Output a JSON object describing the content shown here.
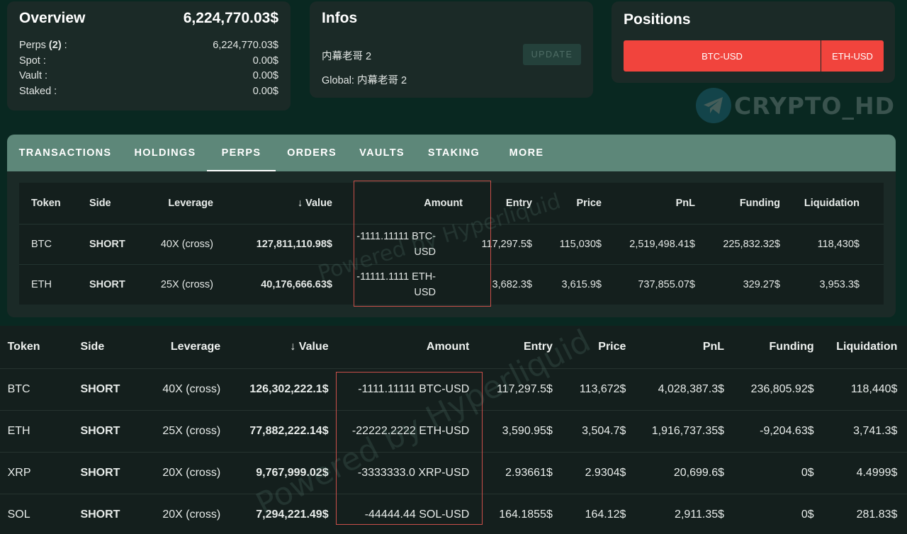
{
  "overview": {
    "title": "Overview",
    "total": "6,224,770.03$",
    "rows": [
      {
        "label_prefix": "Perps ",
        "count": "(2)",
        "label_suffix": " :",
        "value": "6,224,770.03$"
      },
      {
        "label": "Spot :",
        "value": "0.00$"
      },
      {
        "label": "Vault :",
        "value": "0.00$"
      },
      {
        "label": "Staked :",
        "value": "0.00$"
      }
    ]
  },
  "infos": {
    "title": "Infos",
    "name": "内幕老哥 2",
    "global": "Global: 内幕老哥 2",
    "update_label": "UPDATE"
  },
  "positions": {
    "title": "Positions",
    "segments": [
      {
        "label": "BTC-USD",
        "share": 0.757
      },
      {
        "label": "ETH-USD",
        "share": 0.243
      }
    ],
    "bar_color": "#f1443d"
  },
  "watermark_logo": {
    "text": "CRYPTO_HD",
    "icon": "telegram-plane-icon"
  },
  "tabs": [
    {
      "label": "TRANSACTIONS",
      "active": false
    },
    {
      "label": "HOLDINGS",
      "active": false
    },
    {
      "label": "PERPS",
      "active": true
    },
    {
      "label": "ORDERS",
      "active": false
    },
    {
      "label": "VAULTS",
      "active": false
    },
    {
      "label": "STAKING",
      "active": false
    },
    {
      "label": "MORE",
      "active": false
    }
  ],
  "table_headers": [
    "Token",
    "Side",
    "Leverage",
    "Value",
    "Amount",
    "Entry",
    "Price",
    "PnL",
    "Funding",
    "Liquidation"
  ],
  "sort_icon": "arrow-down-icon",
  "table1_rows": [
    {
      "token": "BTC",
      "side": "SHORT",
      "leverage": "40X (cross)",
      "value": "127,811,110.98$",
      "amount_line1": "-1111.11111 BTC-",
      "amount_line2": "USD",
      "entry": "117,297.5$",
      "price": "115,030$",
      "pnl": "2,519,498.41$",
      "funding": "225,832.32$",
      "liquidation": "118,430$"
    },
    {
      "token": "ETH",
      "side": "SHORT",
      "leverage": "25X (cross)",
      "value": "40,176,666.63$",
      "amount_line1": "-11111.1111 ETH-",
      "amount_line2": "USD",
      "entry": "3,682.3$",
      "price": "3,615.9$",
      "pnl": "737,855.07$",
      "funding": "329.27$",
      "liquidation": "3,953.3$"
    }
  ],
  "table2_rows": [
    {
      "token": "BTC",
      "side": "SHORT",
      "leverage": "40X (cross)",
      "value": "126,302,222.1$",
      "amount": "-1111.11111 BTC-USD",
      "entry": "117,297.5$",
      "price": "113,672$",
      "pnl": "4,028,387.3$",
      "funding": "236,805.92$",
      "liquidation": "118,440$"
    },
    {
      "token": "ETH",
      "side": "SHORT",
      "leverage": "25X (cross)",
      "value": "77,882,222.14$",
      "amount": "-22222.2222 ETH-USD",
      "entry": "3,590.95$",
      "price": "3,504.7$",
      "pnl": "1,916,737.35$",
      "funding": "-9,204.63$",
      "liquidation": "3,741.3$"
    },
    {
      "token": "XRP",
      "side": "SHORT",
      "leverage": "20X (cross)",
      "value": "9,767,999.02$",
      "amount": "-3333333.0 XRP-USD",
      "entry": "2.93661$",
      "price": "2.9304$",
      "pnl": "20,699.6$",
      "funding": "0$",
      "liquidation": "4.4999$"
    },
    {
      "token": "SOL",
      "side": "SHORT",
      "leverage": "20X (cross)",
      "value": "7,294,221.49$",
      "amount": "-44444.44 SOL-USD",
      "entry": "164.1855$",
      "price": "164.12$",
      "pnl": "2,911.35$",
      "funding": "0$",
      "liquidation": "281.83$"
    }
  ],
  "watermark_text": "Powered by Hyperliquid",
  "colors": {
    "short": "#f12b2b",
    "positive": "#15a314",
    "negative": "#f12b2b",
    "tab_bar": "#5d8779",
    "highlight": "#c9504a"
  }
}
